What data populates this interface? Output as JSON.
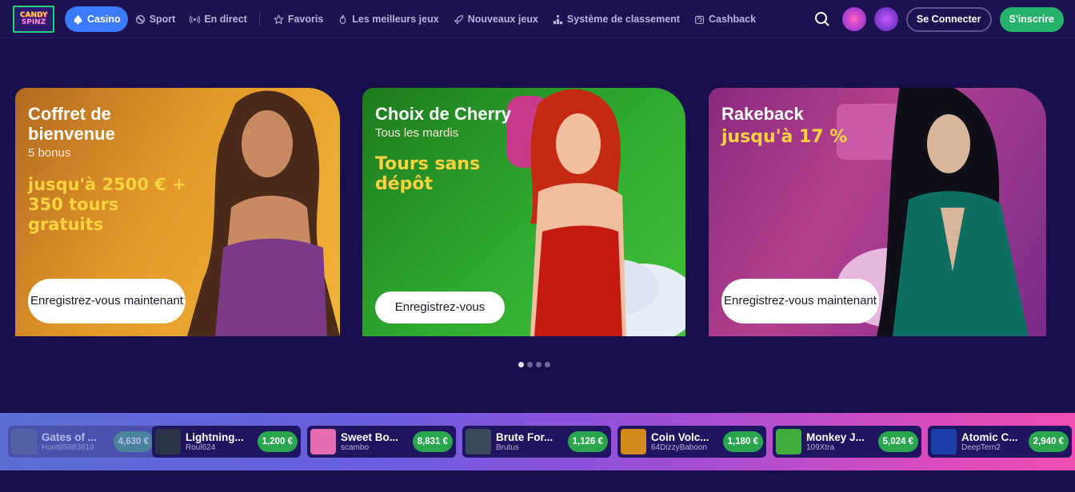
{
  "logo": {
    "line1": "CANDY",
    "line2": "SPINZ"
  },
  "nav": {
    "items": [
      {
        "label": "Casino",
        "icon": "spade-icon",
        "active": true
      },
      {
        "label": "Sport",
        "icon": "ball-icon"
      },
      {
        "label": "En direct",
        "icon": "broadcast-icon"
      },
      {
        "label": "Favoris",
        "icon": "star-icon"
      },
      {
        "label": "Les meilleurs jeux",
        "icon": "flame-icon"
      },
      {
        "label": "Nouveaux jeux",
        "icon": "rocket-icon"
      },
      {
        "label": "Système de classement",
        "icon": "podium-icon"
      },
      {
        "label": "Cashback",
        "icon": "cashback-icon"
      }
    ],
    "login_label": "Se Connecter",
    "signup_label": "S'inscrire"
  },
  "banners": [
    {
      "title": "Coffret de bienvenue",
      "subtitle": "5 bonus",
      "accent": "jusqu'à 2500 € + 350 tours gratuits",
      "button": "Enregistrez-vous maintenant",
      "accent_color": "#ffd23f"
    },
    {
      "title": "Choix de Cherry",
      "subtitle": "Tous les mardis",
      "accent": "Tours sans dépôt",
      "button": "Enregistrez-vous",
      "accent_color": "#ffd23f"
    },
    {
      "title": "Rakeback",
      "subtitle": "",
      "accent": "jusqu'à 17 %",
      "button": "Enregistrez-vous maintenant",
      "accent_color": "#ffd23f"
    }
  ],
  "carousel": {
    "pages": 4,
    "active": 0
  },
  "wins": [
    {
      "game": "Gates of ...",
      "user": "Hunt95883819",
      "amount": "4,630 €",
      "thumb": "#4a5a80"
    },
    {
      "game": "Lightning...",
      "user": "Roul624",
      "amount": "1,200 €",
      "thumb": "#2a3348"
    },
    {
      "game": "Sweet Bo...",
      "user": "scambo",
      "amount": "8,831 €",
      "thumb": "#e86ab0"
    },
    {
      "game": "Brute For...",
      "user": "Brutus",
      "amount": "1,126 €",
      "thumb": "#3a4a5c"
    },
    {
      "game": "Coin Volc...",
      "user": "64DizzyBaboon",
      "amount": "1,180 €",
      "thumb": "#d48a1a"
    },
    {
      "game": "Monkey J...",
      "user": "109Xtra",
      "amount": "5,024 €",
      "thumb": "#3fae3a"
    },
    {
      "game": "Atomic C...",
      "user": "DeepTern2",
      "amount": "2,940 €",
      "thumb": "#1e3ea8"
    }
  ],
  "colors": {
    "background": "#1a0f4d",
    "nav_active": "#3a7bff",
    "signup": "#25b26b",
    "amount_badge": "#2aa64f"
  }
}
